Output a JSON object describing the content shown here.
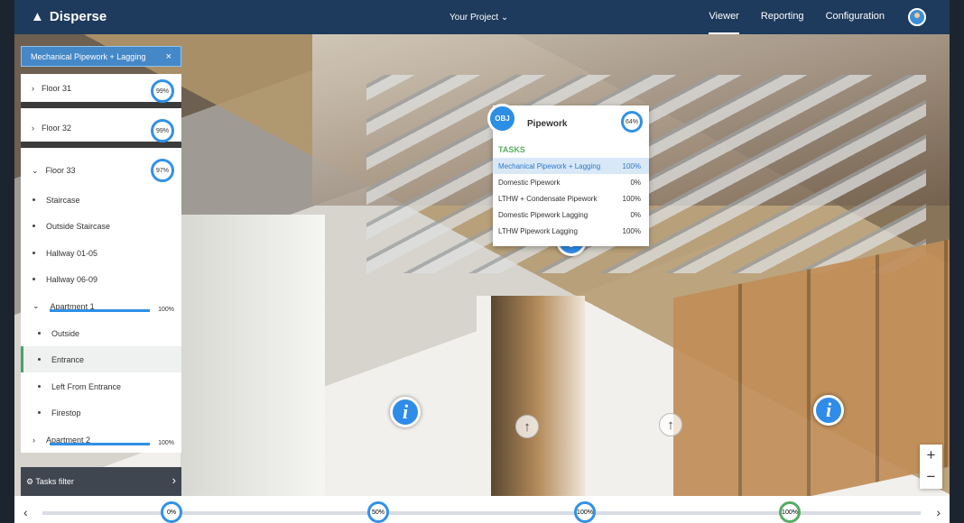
{
  "app": {
    "brand": "Disperse",
    "project": "Your Project ⌄"
  },
  "nav": {
    "viewer": "Viewer",
    "reporting": "Reporting",
    "configuration": "Configuration"
  },
  "filter": {
    "chip": "Mechanical Pipework + Lagging",
    "close": "×",
    "tasks_filter": "Tasks filter",
    "arrow": "›"
  },
  "floors": [
    {
      "label": "Floor 31",
      "percent": "99%"
    },
    {
      "label": "Floor 32",
      "percent": "99%"
    },
    {
      "label": "Floor 33",
      "percent": "97%"
    }
  ],
  "rooms": [
    {
      "label": "Staircase"
    },
    {
      "label": "Outside Staircase"
    },
    {
      "label": "Hallway 01-05"
    },
    {
      "label": "Hallway 06-09"
    },
    {
      "label": "Apartment 1",
      "percent": "100%",
      "progress": 100
    },
    {
      "label": "Outside"
    },
    {
      "label": "Entrance"
    },
    {
      "label": "Left From Entrance"
    },
    {
      "label": "Firestop"
    },
    {
      "label": "Apartment 2",
      "percent": "100%",
      "progress": 100
    }
  ],
  "popup": {
    "obj": "OBJ",
    "title": "Pipework",
    "percent": "64%",
    "tasks_heading": "TASKS",
    "tasks": [
      {
        "name": "Mechanical Pipework + Lagging",
        "value": "100%"
      },
      {
        "name": "Domestic Pipework",
        "value": "0%"
      },
      {
        "name": "LTHW + Condensate Pipework",
        "value": "100%"
      },
      {
        "name": "Domestic Pipework Lagging",
        "value": "0%"
      },
      {
        "name": "LTHW Pipework Lagging",
        "value": "100%"
      }
    ]
  },
  "timeline": [
    "0%",
    "50%",
    "100%",
    "100%"
  ],
  "icons": {
    "info": "i",
    "up": "↑",
    "plus": "+",
    "minus": "−",
    "chat": "💬",
    "left": "‹",
    "right": "›",
    "filter": "⚙",
    "chevron_right": "›",
    "chevron_down": "⌄"
  }
}
